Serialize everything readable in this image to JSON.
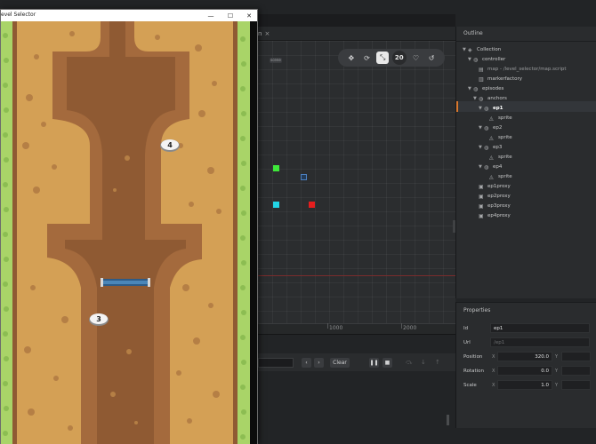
{
  "window": {
    "title": "evel Selector",
    "min_glyph": "—",
    "max_glyph": "☐",
    "close_glyph": "✕"
  },
  "levels": [
    {
      "label": "4"
    },
    {
      "label": "3"
    }
  ],
  "editor": {
    "scene_tab_label": "n",
    "scene_tab_close": "×",
    "grid_size": "20",
    "ruler_ticks": [
      "1000",
      "2000"
    ],
    "scene_badge": "scene",
    "console": {
      "prev": "‹",
      "next": "›",
      "clear": "Clear",
      "pause": "❚❚",
      "stop": "■"
    }
  },
  "outline": {
    "title": "Outline",
    "items": [
      {
        "label": "Collection",
        "depth": 0,
        "expanded": true,
        "icon": "collection-icon"
      },
      {
        "label": "controller",
        "depth": 1,
        "expanded": true,
        "icon": "game-object-icon"
      },
      {
        "label": "map - /level_selector/map.script",
        "depth": 2,
        "expanded": false,
        "icon": "script-icon",
        "dim": true
      },
      {
        "label": "markerfactory",
        "depth": 2,
        "expanded": false,
        "icon": "factory-icon"
      },
      {
        "label": "episodes",
        "depth": 1,
        "expanded": true,
        "icon": "game-object-icon"
      },
      {
        "label": "anchors",
        "depth": 2,
        "expanded": true,
        "icon": "game-object-icon"
      },
      {
        "label": "ep1",
        "depth": 3,
        "expanded": true,
        "icon": "game-object-icon",
        "selected": true
      },
      {
        "label": "sprite",
        "depth": 4,
        "expanded": false,
        "icon": "sprite-icon"
      },
      {
        "label": "ep2",
        "depth": 3,
        "expanded": true,
        "icon": "game-object-icon"
      },
      {
        "label": "sprite",
        "depth": 4,
        "expanded": false,
        "icon": "sprite-icon"
      },
      {
        "label": "ep3",
        "depth": 3,
        "expanded": true,
        "icon": "game-object-icon"
      },
      {
        "label": "sprite",
        "depth": 4,
        "expanded": false,
        "icon": "sprite-icon"
      },
      {
        "label": "ep4",
        "depth": 3,
        "expanded": true,
        "icon": "game-object-icon"
      },
      {
        "label": "sprite",
        "depth": 4,
        "expanded": false,
        "icon": "sprite-icon"
      },
      {
        "label": "ep1proxy",
        "depth": 2,
        "expanded": false,
        "icon": "proxy-icon"
      },
      {
        "label": "ep2proxy",
        "depth": 2,
        "expanded": false,
        "icon": "proxy-icon"
      },
      {
        "label": "ep3proxy",
        "depth": 2,
        "expanded": false,
        "icon": "proxy-icon"
      },
      {
        "label": "ep4proxy",
        "depth": 2,
        "expanded": false,
        "icon": "proxy-icon"
      }
    ]
  },
  "properties": {
    "title": "Properties",
    "id_label": "Id",
    "id_value": "ep1",
    "url_label": "Url",
    "url_value": "/ep1",
    "position_label": "Position",
    "position_x": "320.0",
    "rotation_label": "Rotation",
    "rotation_x": "0.0",
    "scale_label": "Scale",
    "scale_x": "1.0",
    "axis_x": "X",
    "axis_y": "Y"
  },
  "colors": {
    "marker_green": "#3ee83a",
    "marker_blue": "#4b7fbf",
    "marker_cyan": "#22d5e6",
    "marker_red": "#e51e1e",
    "selection_accent": "#d8782e",
    "map_sand": "#d4a055",
    "map_path": "#a46a3d",
    "map_grass": "#b8e07a"
  }
}
